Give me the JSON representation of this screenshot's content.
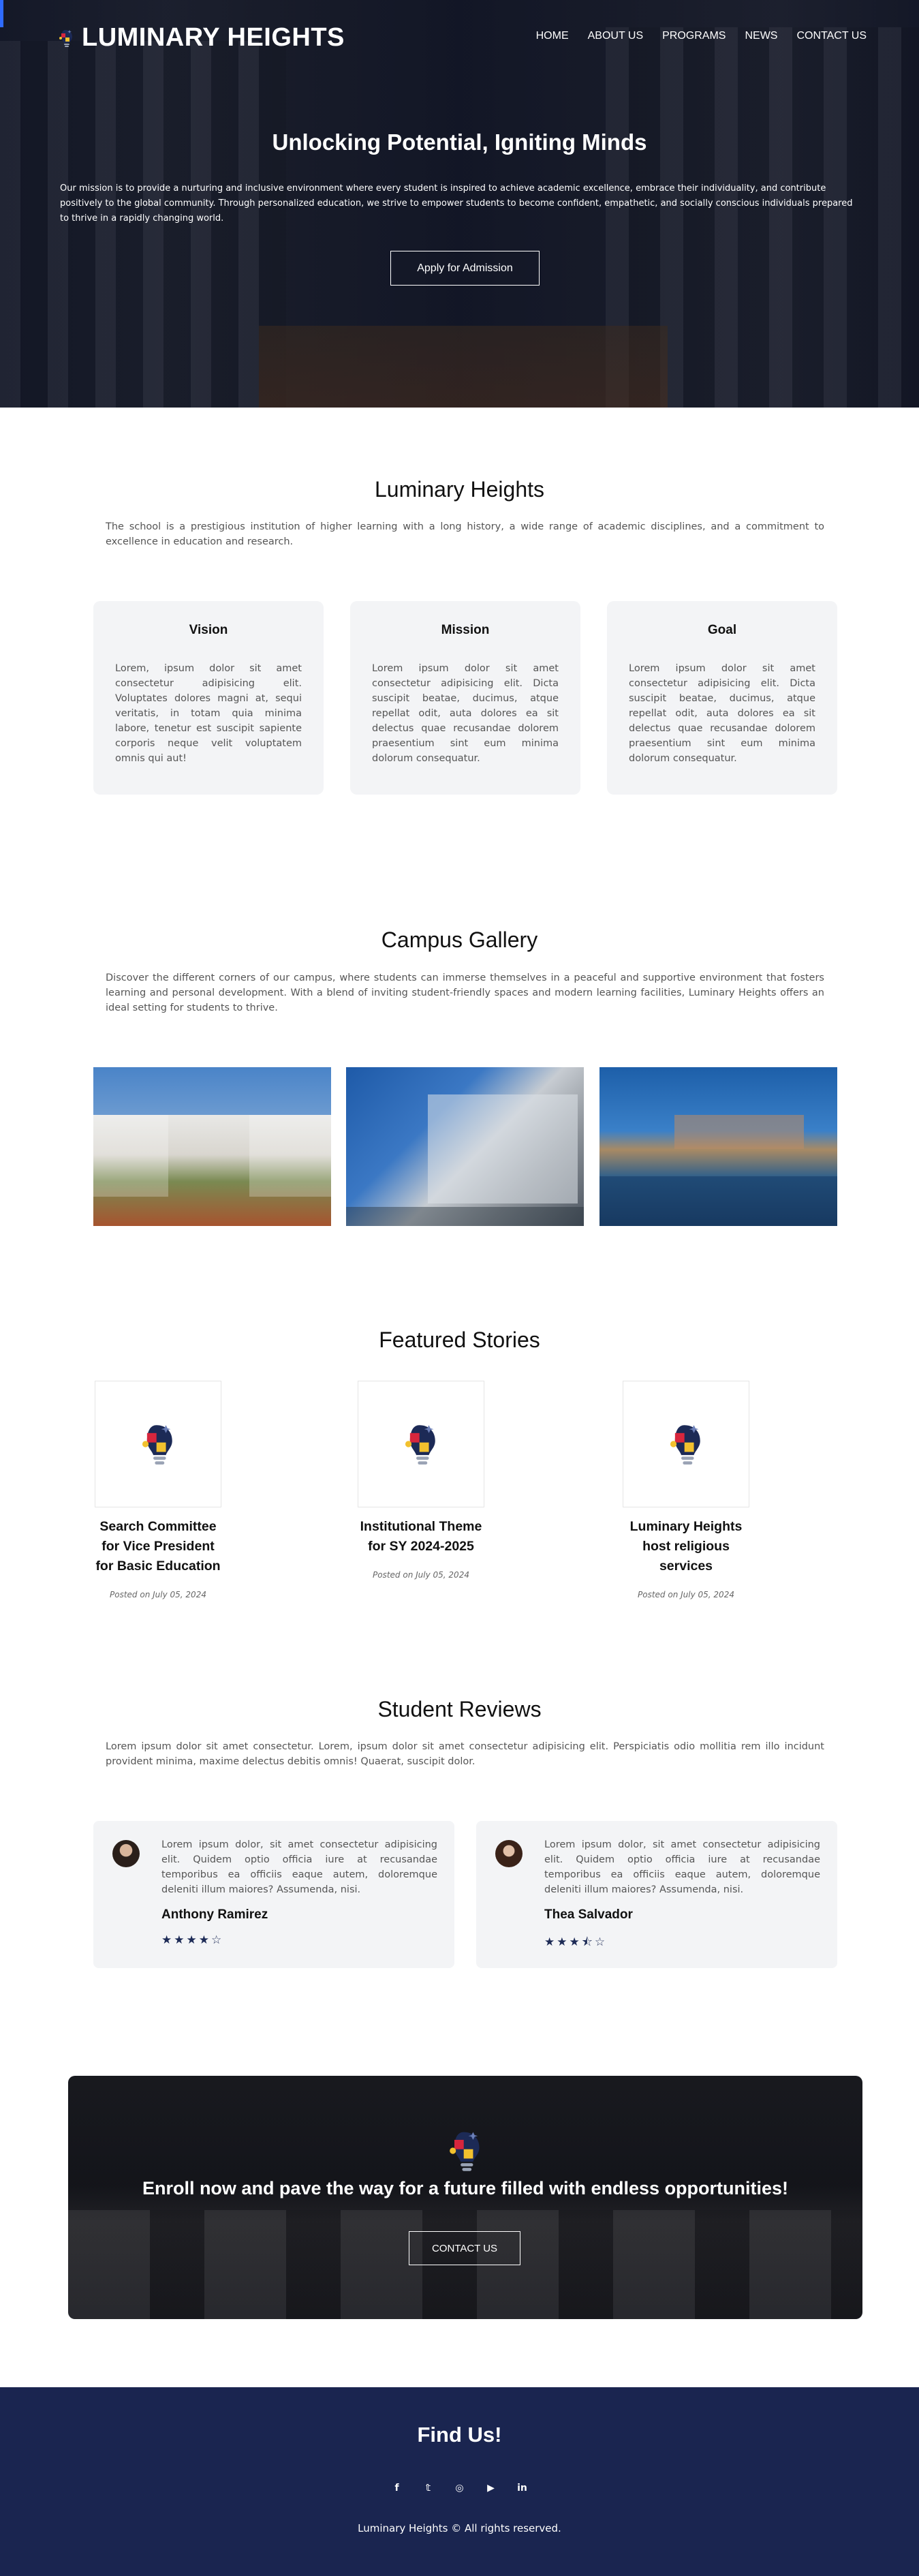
{
  "brand": {
    "name": "LUMINARY HEIGHTS"
  },
  "nav": {
    "items": [
      "HOME",
      "ABOUT US",
      "PROGRAMS",
      "NEWS",
      "CONTACT US"
    ]
  },
  "hero": {
    "title": "Unlocking Potential, Igniting Minds",
    "text": "Our mission is to provide a nurturing and inclusive environment where every student is inspired to achieve academic excellence, embrace their individuality, and contribute positively to the global community. Through personalized education, we strive to empower students to become confident, empathetic, and socially conscious individuals prepared to thrive in a rapidly changing world.",
    "button": "Apply for Admission"
  },
  "about": {
    "title": "Luminary Heights",
    "text": "The school is a prestigious institution of higher learning with a long history, a wide range of academic disciplines, and a commitment to excellence in education and research.",
    "cards": [
      {
        "title": "Vision",
        "text": "Lorem, ipsum dolor sit amet consectetur adipisicing elit. Voluptates dolores magni at, sequi veritatis, in totam quia minima labore, tenetur est suscipit sapiente corporis neque velit voluptatem omnis qui aut!"
      },
      {
        "title": "Mission",
        "text": "Lorem ipsum dolor sit amet consectetur adipisicing elit. Dicta suscipit beatae, ducimus, atque repellat odit, auta dolores ea sit delectus quae recusandae dolorem praesentium sint eum minima dolorum consequatur."
      },
      {
        "title": "Goal",
        "text": "Lorem ipsum dolor sit amet consectetur adipisicing elit. Dicta suscipit beatae, ducimus, atque repellat odit, auta dolores ea sit delectus quae recusandae dolorem praesentium sint eum minima dolorum consequatur."
      }
    ]
  },
  "gallery": {
    "title": "Campus Gallery",
    "text": "Discover the different corners of our campus, where students can immerse themselves in a peaceful and supportive environment that fosters learning and personal development. With a blend of inviting student-friendly spaces and modern learning facilities, Luminary Heights offers an ideal setting for students to thrive."
  },
  "stories": {
    "title": "Featured Stories",
    "items": [
      {
        "title": "Search Committee for Vice President for Basic Education",
        "date": "Posted on July 05, 2024"
      },
      {
        "title": "Institutional Theme for SY 2024-2025",
        "date": "Posted on July 05, 2024"
      },
      {
        "title": "Luminary Heights host religious services",
        "date": "Posted on July 05, 2024"
      }
    ]
  },
  "reviews": {
    "title": "Student Reviews",
    "text": "Lorem ipsum dolor sit amet consectetur. Lorem, ipsum dolor sit amet consectetur adipisicing elit. Perspiciatis odio mollitia rem illo incidunt provident minima, maxime delectus debitis omnis! Quaerat, suscipit dolor.",
    "items": [
      {
        "text": "Lorem ipsum dolor, sit amet consectetur adipisicing elit. Quidem optio officia iure at recusandae temporibus ea officiis eaque autem, doloremque deleniti illum maiores? Assumenda, nisi.",
        "name": "Anthony Ramirez",
        "rating": 4,
        "stars": "★★★★☆"
      },
      {
        "text": "Lorem ipsum dolor, sit amet consectetur adipisicing elit. Quidem optio officia iure at recusandae temporibus ea officiis eaque autem, doloremque deleniti illum maiores? Assumenda, nisi.",
        "name": "Thea Salvador",
        "rating": 3.5,
        "stars": "★★★⯪☆"
      }
    ]
  },
  "cta": {
    "title": "Enroll now and pave the way for a future filled with endless opportunities!",
    "button": "CONTACT US"
  },
  "footer": {
    "title": "Find Us!",
    "socials": [
      {
        "icon": "facebook-icon",
        "glyph": "f"
      },
      {
        "icon": "twitter-icon",
        "glyph": "𝕥"
      },
      {
        "icon": "instagram-icon",
        "glyph": "◎"
      },
      {
        "icon": "youtube-icon",
        "glyph": "▶"
      },
      {
        "icon": "linkedin-icon",
        "glyph": "in"
      }
    ],
    "copyright": "Luminary Heights © All rights reserved."
  },
  "colors": {
    "navy": "#1a2550",
    "accent_blue": "#2f6bff",
    "card_bg": "#f3f4f6"
  }
}
